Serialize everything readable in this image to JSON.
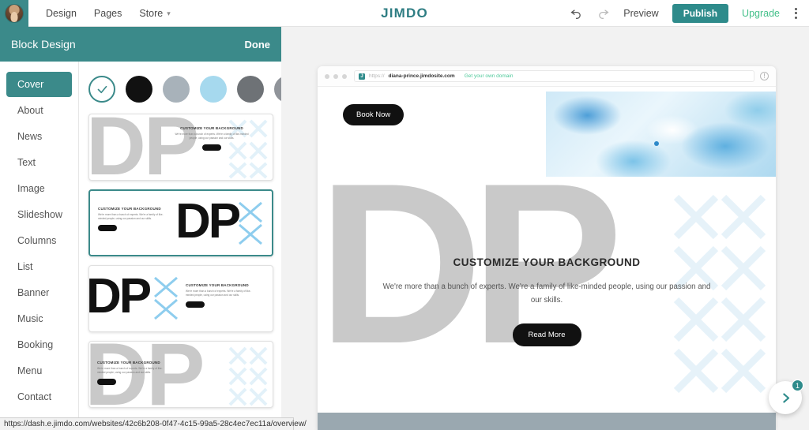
{
  "topbar": {
    "avatar_alt": "user-avatar",
    "nav": [
      {
        "label": "Design",
        "has_caret": false
      },
      {
        "label": "Pages",
        "has_caret": false
      },
      {
        "label": "Store",
        "has_caret": true
      }
    ],
    "brand": "JIMDO",
    "undo_icon": "undo-icon",
    "redo_icon": "redo-icon",
    "preview_label": "Preview",
    "publish_label": "Publish",
    "upgrade_label": "Upgrade",
    "menu_icon": "kebab-menu-icon",
    "publish_color": "#2e8b8b",
    "upgrade_color": "#44c08a",
    "brand_color": "#2e7d83"
  },
  "panel": {
    "title": "Block Design",
    "done_label": "Done",
    "header_color": "#3b8a8a",
    "sidebar_items": [
      {
        "label": "Cover",
        "active": true
      },
      {
        "label": "About",
        "active": false
      },
      {
        "label": "News",
        "active": false
      },
      {
        "label": "Text",
        "active": false
      },
      {
        "label": "Image",
        "active": false
      },
      {
        "label": "Slideshow",
        "active": false
      },
      {
        "label": "Columns",
        "active": false
      },
      {
        "label": "List",
        "active": false
      },
      {
        "label": "Banner",
        "active": false
      },
      {
        "label": "Music",
        "active": false
      },
      {
        "label": "Booking",
        "active": false
      },
      {
        "label": "Menu",
        "active": false
      },
      {
        "label": "Contact",
        "active": false
      }
    ],
    "swatches": [
      {
        "name": "swatch-selected-check",
        "color": "#ffffff",
        "selected": true
      },
      {
        "name": "swatch-black",
        "color": "#111111",
        "selected": false
      },
      {
        "name": "swatch-light-gray-blue",
        "color": "#a8b2ba",
        "selected": false
      },
      {
        "name": "swatch-light-blue",
        "color": "#a6d9ee",
        "selected": false
      },
      {
        "name": "swatch-dark-gray",
        "color": "#6e7276",
        "selected": false
      },
      {
        "name": "swatch-medium-gray",
        "color": "#90949a",
        "selected": false
      }
    ],
    "thumbnails": [
      {
        "name": "layout-gray-dp-left-text-center",
        "selected": false,
        "dp_text": "DP",
        "heading": "CUSTOMIZE YOUR BACKGROUND",
        "body": "We're more than a bunch of experts. We're a family of like-minded people, using our passion and our skills."
      },
      {
        "name": "layout-text-left-black-dp-right",
        "selected": true,
        "dp_text": "DP",
        "heading": "CUSTOMIZE YOUR BACKGROUND",
        "body": "We're more than a bunch of experts. We're a family of like-minded people, using our passion and our skills."
      },
      {
        "name": "layout-black-dp-left-text-right",
        "selected": false,
        "dp_text": "DP",
        "heading": "CUSTOMIZE YOUR BACKGROUND",
        "body": "We're more than a bunch of experts. We're a family of like-minded people, using our passion and our skills."
      },
      {
        "name": "layout-gray-dp-overlay-text-left",
        "selected": false,
        "dp_text": "DP",
        "heading": "CUSTOMIZE YOUR BACKGROUND",
        "body": "We're more than a bunch of experts. We're a family of like-minded people, using our passion and our skills."
      }
    ]
  },
  "preview": {
    "url_protocol": "https://",
    "url_host": "diana-prince.jimdosite.com",
    "domain_link": "Get your own domain",
    "favicon_glyph": "J",
    "info_glyph": "!",
    "book_now_label": "Book Now",
    "big_letters": "DP",
    "heading": "CUSTOMIZE YOUR BACKGROUND",
    "body": "We're more than a bunch of experts. We're a family of like-minded people, using our passion and our skills.",
    "read_more_label": "Read More"
  },
  "help": {
    "icon": "chevron-right-icon",
    "badge_count": "1",
    "badge_color": "#2e8b8b"
  },
  "statusbar": {
    "url": "https://dash.e.jimdo.com/websites/42c6b208-0f47-4c15-99a5-28c4ec7ec11a/overview/"
  }
}
